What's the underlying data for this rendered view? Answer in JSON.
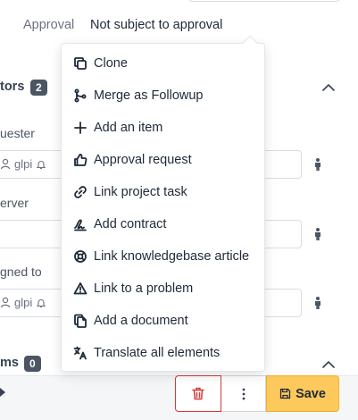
{
  "approval": {
    "label": "Approval",
    "value": "Not subject to approval"
  },
  "actors": {
    "title": "tors",
    "count": "2",
    "requester_label": "uester",
    "observer_label": "erver",
    "assigned_label": "gned to",
    "requester_chip": "glpi",
    "assigned_chip": "glpi"
  },
  "items_section": {
    "title": "ms",
    "count": "0"
  },
  "menu": {
    "items": [
      {
        "label": "Clone",
        "icon": "copy-icon"
      },
      {
        "label": "Merge as Followup",
        "icon": "git-merge-icon"
      },
      {
        "label": "Add an item",
        "icon": "plus-icon"
      },
      {
        "label": "Approval request",
        "icon": "thumb-up-icon"
      },
      {
        "label": "Link project task",
        "icon": "link-icon"
      },
      {
        "label": "Add contract",
        "icon": "signature-icon"
      },
      {
        "label": "Link knowledgebase article",
        "icon": "lifebuoy-icon"
      },
      {
        "label": "Link to a problem",
        "icon": "alert-triangle-icon"
      },
      {
        "label": "Add a document",
        "icon": "files-icon"
      },
      {
        "label": "Translate all elements",
        "icon": "language-icon"
      }
    ]
  },
  "footer": {
    "save_label": "Save"
  },
  "colors": {
    "delete_border": "#d63939",
    "save_bg": "#fec95c",
    "badge_bg": "#4b5563"
  }
}
